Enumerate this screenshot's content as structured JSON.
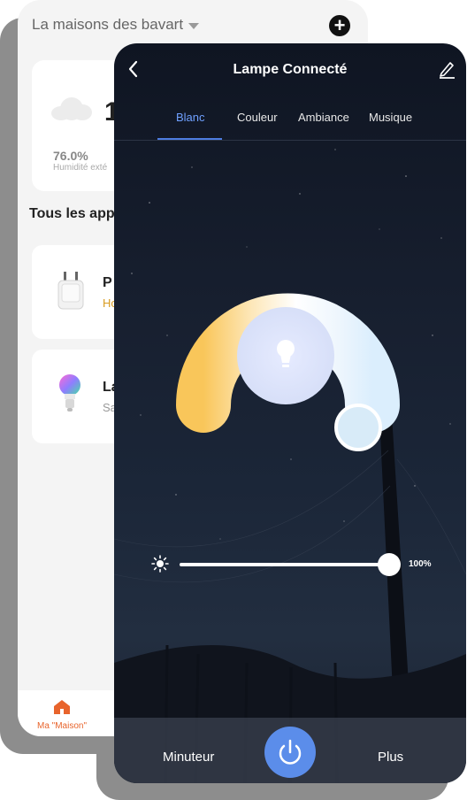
{
  "home": {
    "home_name": "La maisons des bavart",
    "weather": {
      "temperature": "1",
      "humidity_value": "76.0%",
      "humidity_label": "Humidité exté"
    },
    "section_title": "Tous les app",
    "devices": [
      {
        "name": "P",
        "status": "Ho"
      },
      {
        "name": "La",
        "status": "Sa"
      }
    ],
    "bottom_nav": {
      "home_tab_label": "Ma \"Maison\""
    }
  },
  "lamp": {
    "title": "Lampe Connecté",
    "tabs": [
      {
        "label": "Blanc",
        "active": true
      },
      {
        "label": "Couleur",
        "active": false
      },
      {
        "label": "Ambiance",
        "active": false
      },
      {
        "label": "Musique",
        "active": false
      }
    ],
    "brightness_value": "100%",
    "brightness_level": 1.0,
    "timer_label": "Minuteur",
    "more_label": "Plus"
  },
  "icons": {
    "back": "chevron-left-icon",
    "edit": "pencil-icon",
    "bulb": "lightbulb-icon",
    "sun": "sun-icon",
    "power": "power-icon",
    "add": "plus-circle-icon",
    "home": "home-icon",
    "cloud": "cloud-icon"
  },
  "colors": {
    "accent": "#5b8dea",
    "active_tab": "#6fa0ff",
    "home_tab_accent": "#e8642c",
    "warm_white": "#f9c65a",
    "cool_white": "#dbeefd"
  }
}
